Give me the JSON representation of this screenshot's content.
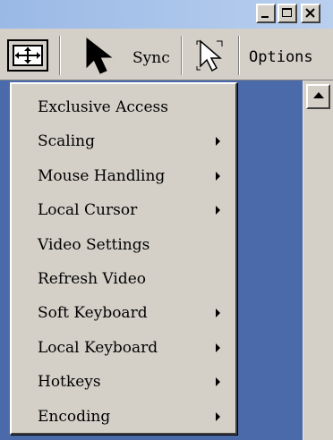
{
  "window": {
    "controls": [
      {
        "name": "minimize-button",
        "icon": "minimize-icon"
      },
      {
        "name": "maximize-button",
        "icon": "maximize-icon"
      },
      {
        "name": "close-button",
        "icon": "close-icon"
      }
    ]
  },
  "toolbar": {
    "fit_icon": "fit-window-icon",
    "cursor_icon": "black-cursor-icon",
    "sync_label": "Sync",
    "outline_cursor_icon": "white-cursor-icon",
    "options_label": "Options"
  },
  "menu": {
    "items": [
      {
        "label": "Exclusive Access",
        "submenu": false
      },
      {
        "label": "Scaling",
        "submenu": true
      },
      {
        "label": "Mouse Handling",
        "submenu": true
      },
      {
        "label": "Local Cursor",
        "submenu": true
      },
      {
        "label": "Video Settings",
        "submenu": false
      },
      {
        "label": "Refresh Video",
        "submenu": false
      },
      {
        "label": "Soft Keyboard",
        "submenu": true
      },
      {
        "label": "Local Keyboard",
        "submenu": true
      },
      {
        "label": "Hotkeys",
        "submenu": true
      },
      {
        "label": "Encoding",
        "submenu": true
      }
    ]
  },
  "colors": {
    "title_bar": "#9ab9e6",
    "content_background": "#4a6aaa",
    "face": "#d4d0c8"
  }
}
